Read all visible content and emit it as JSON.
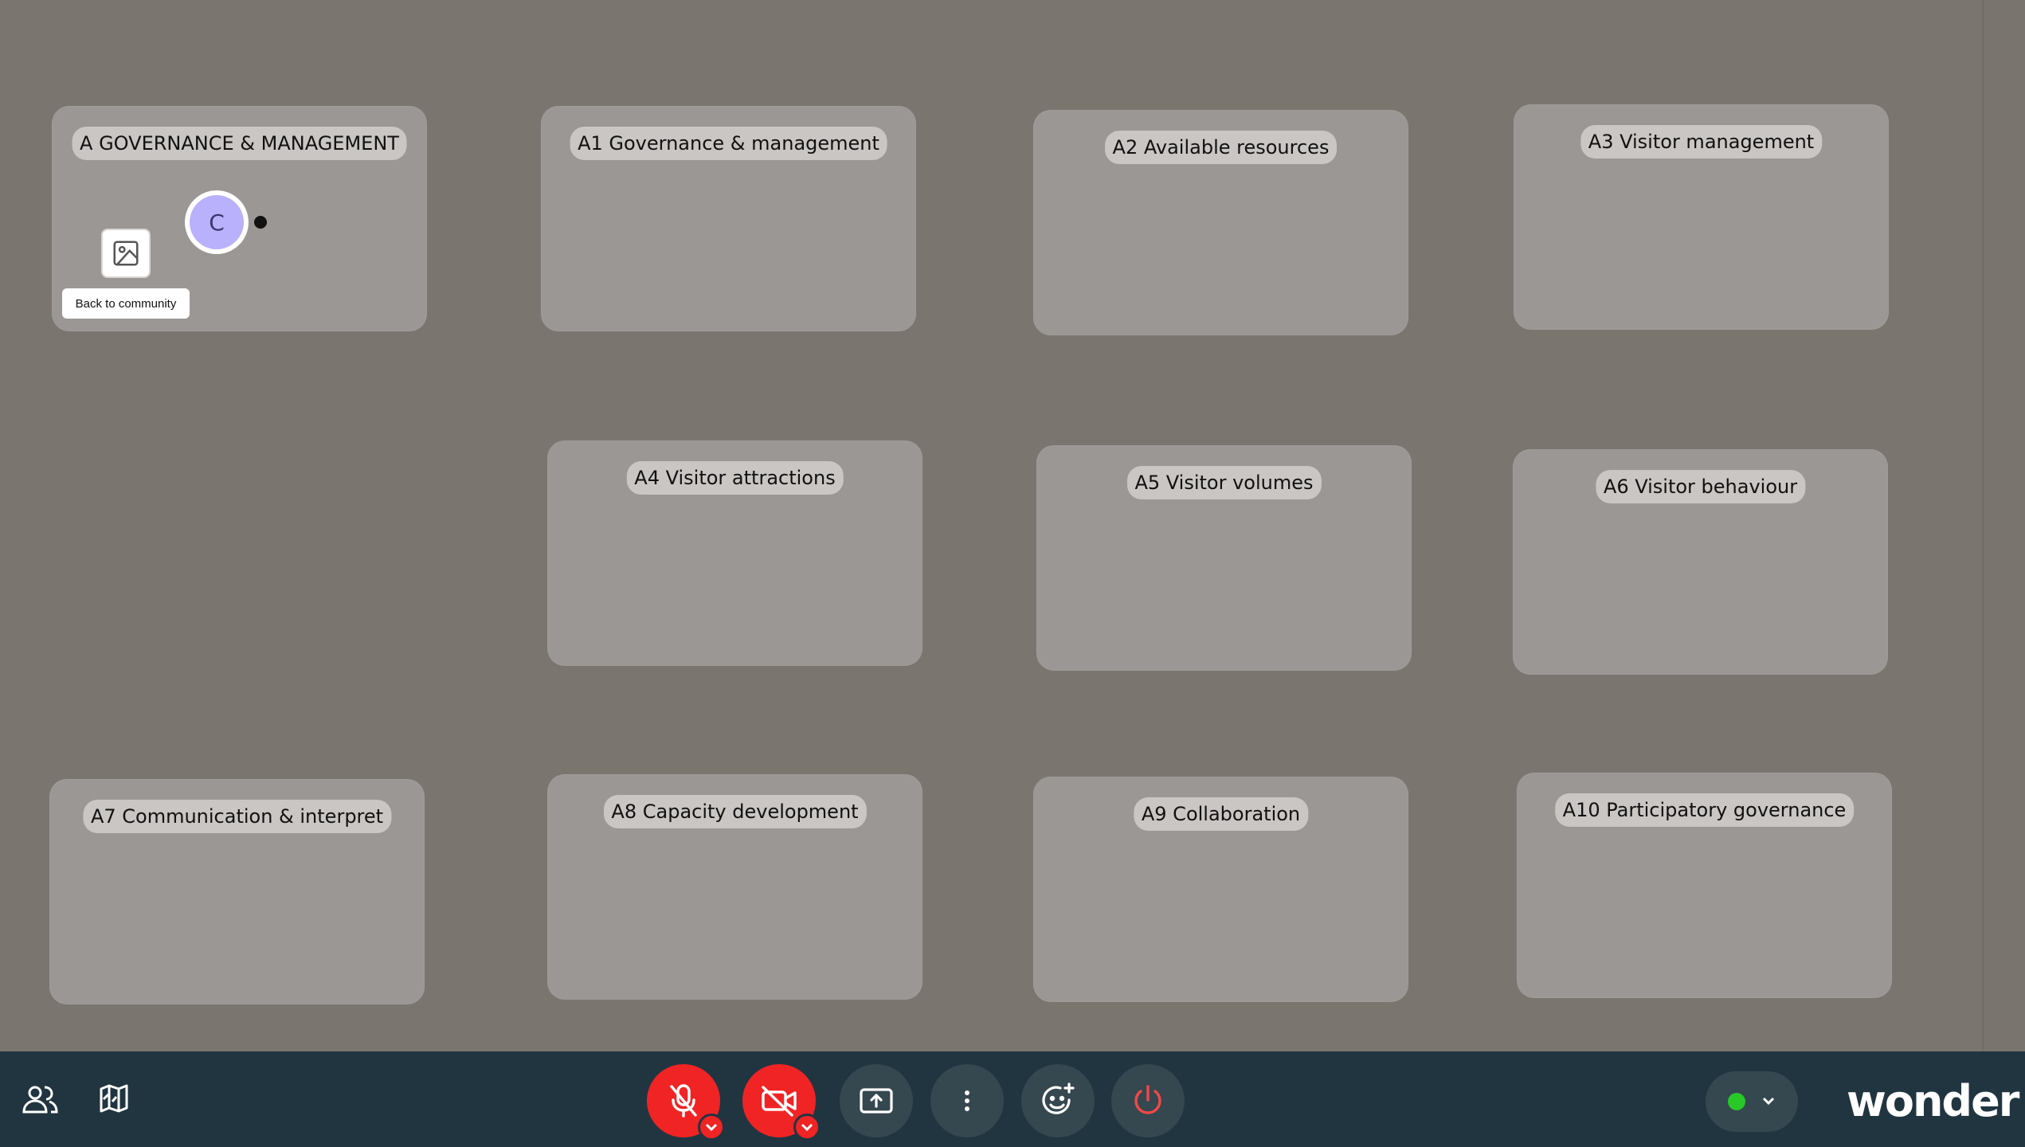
{
  "rooms": [
    {
      "label": "A GOVERNANCE & MANAGEMENT"
    },
    {
      "label": "A1 Governance & management"
    },
    {
      "label": "A2 Available resources"
    },
    {
      "label": "A3 Visitor management"
    },
    {
      "label": "A4 Visitor attractions"
    },
    {
      "label": "A5 Visitor volumes"
    },
    {
      "label": "A6 Visitor behaviour"
    },
    {
      "label": "A7 Communication & interpret"
    },
    {
      "label": "A8 Capacity development"
    },
    {
      "label": "A9 Collaboration"
    },
    {
      "label": "A10 Participatory governance"
    }
  ],
  "participant": {
    "initial": "C",
    "avatar_color": "#b9b1fb"
  },
  "back_link": {
    "label": "Back to community"
  },
  "toolbar": {
    "logo_text": "wonder",
    "colors": {
      "background": "#213541",
      "danger": "#f02424",
      "status_ok": "#28c828"
    },
    "icons": [
      "people-icon",
      "map-icon",
      "mic-off-icon",
      "camera-off-icon",
      "share-screen-icon",
      "more-icon",
      "emoji-icon",
      "leave-icon",
      "chevron-down-icon"
    ]
  }
}
